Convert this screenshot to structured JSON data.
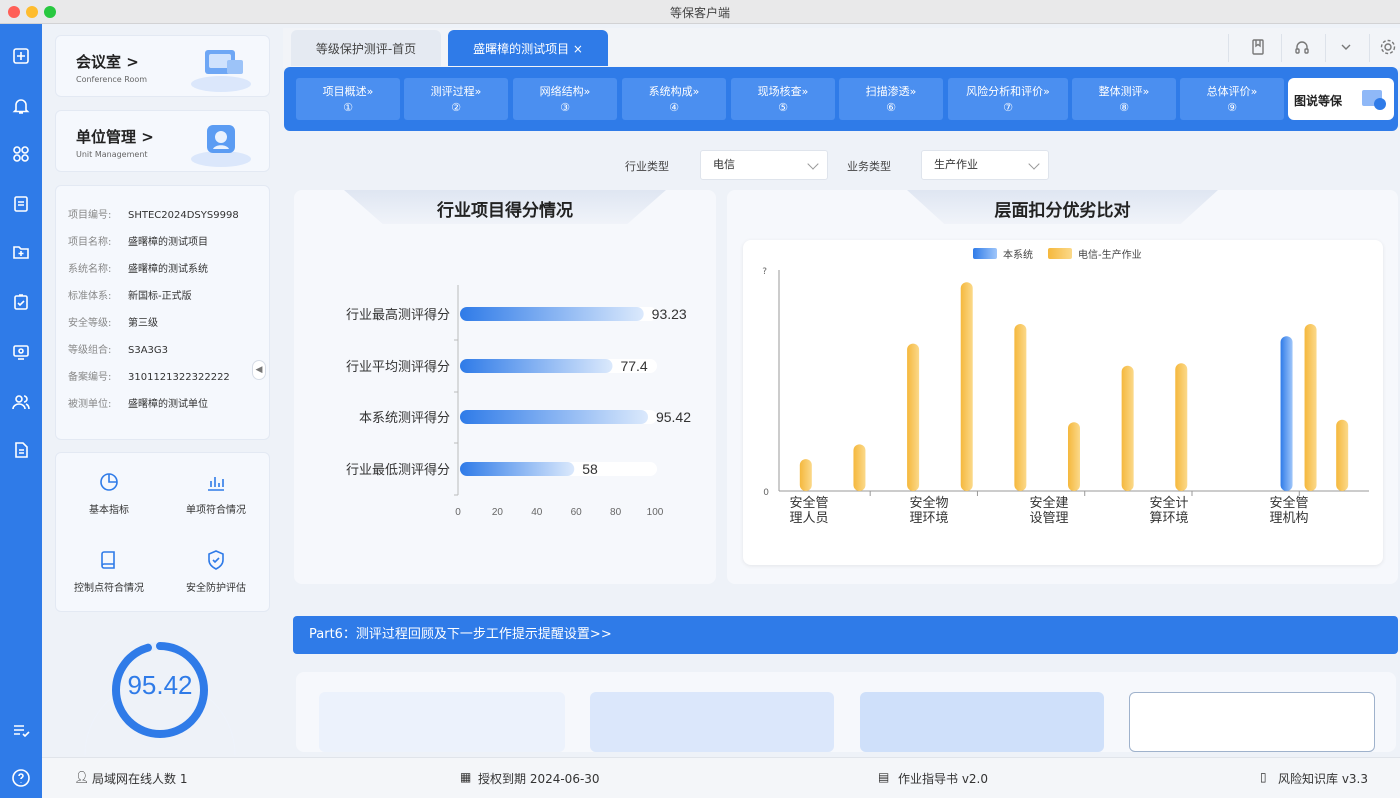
{
  "window": {
    "title": "等保客户端"
  },
  "left_panel": {
    "conference": {
      "title": "会议室 >",
      "subtitle": "Conference Room"
    },
    "unit": {
      "title": "单位管理 >",
      "subtitle": "Unit Management"
    },
    "info": [
      {
        "label": "项目编号:",
        "value": "SHTEC2024DSYS9998"
      },
      {
        "label": "项目名称:",
        "value": "盛曙樟的测试项目"
      },
      {
        "label": "系统名称:",
        "value": "盛曙樟的测试系统"
      },
      {
        "label": "标准体系:",
        "value": "新国标-正式版"
      },
      {
        "label": "安全等级:",
        "value": "第三级"
      },
      {
        "label": "等级组合:",
        "value": "S3A3G3"
      },
      {
        "label": "备案编号:",
        "value": "3101121322322222"
      },
      {
        "label": "被测单位:",
        "value": "盛曙樟的测试单位"
      }
    ],
    "collapse_glyph": "◀",
    "quick": [
      {
        "label": "基本指标"
      },
      {
        "label": "单项符合情况"
      },
      {
        "label": "控制点符合情况"
      },
      {
        "label": "安全防护评估"
      }
    ],
    "score": "95.42",
    "score_fraction": 0.9542
  },
  "tabs": [
    {
      "label": "等级保护测评-首页"
    },
    {
      "label": "盛曙樟的测试项目 ×"
    }
  ],
  "steps": [
    {
      "label": "项目概述»",
      "num": "①"
    },
    {
      "label": "测评过程»",
      "num": "②"
    },
    {
      "label": "网络结构»",
      "num": "③"
    },
    {
      "label": "系统构成»",
      "num": "④"
    },
    {
      "label": "现场核查»",
      "num": "⑤"
    },
    {
      "label": "扫描渗透»",
      "num": "⑥"
    },
    {
      "label": "风险分析和评价»",
      "num": "⑦"
    },
    {
      "label": "整体测评»",
      "num": "⑧"
    },
    {
      "label": "总体评价»",
      "num": "⑨"
    }
  ],
  "final_step": "图说等保",
  "filters": {
    "industry_label": "行业类型",
    "industry_value": "电信",
    "business_label": "业务类型",
    "business_value": "生产作业"
  },
  "panel_left_title": "行业项目得分情况",
  "panel_right_title": "层面扣分优劣比对",
  "chart_data": [
    {
      "type": "bar",
      "orientation": "horizontal",
      "categories": [
        "行业最高测评得分",
        "行业平均测评得分",
        "本系统测评得分",
        "行业最低测评得分"
      ],
      "values": [
        93.23,
        77.4,
        95.42,
        58
      ],
      "value_labels": [
        "93.23",
        "77.4",
        "95.42",
        "58"
      ],
      "xlim": [
        0,
        100
      ],
      "xticks": [
        "0",
        "20",
        "40",
        "60",
        "80",
        "100"
      ],
      "grid": false
    },
    {
      "type": "bar",
      "categories": [
        "安全管理人员",
        "安全物理环境",
        "安全建设管理",
        "安全计算环境",
        "安全管理机构"
      ],
      "x_tick_labels": [
        [
          "安全管",
          "理人员"
        ],
        [
          "安全物",
          "理环境"
        ],
        [
          "安全建",
          "设管理"
        ],
        [
          "安全计",
          "算环境"
        ],
        [
          "安全管",
          "理机构"
        ]
      ],
      "series": [
        {
          "name": "本系统",
          "color": "#3d8bf0",
          "values": [
            0,
            0,
            0,
            0,
            0,
            0,
            0,
            0,
            0,
            6.3,
            0
          ]
        },
        {
          "name": "电信-生产作业",
          "color": "#f5b83d",
          "values": [
            1.3,
            1.9,
            6.0,
            8.5,
            6.8,
            2.8,
            5.1,
            5.2,
            0,
            6.8,
            2.9
          ]
        }
      ],
      "slots": 11,
      "ylim": [
        0,
        9
      ],
      "yticks": [
        "0",
        "?"
      ],
      "legend": "top-center"
    }
  ],
  "part6": "Part6：测评过程回顾及下一步工作提示提醒设置>>",
  "status": {
    "online": "局域网在线人数 1",
    "license": "授权到期 2024-06-30",
    "guide": "作业指导书 v2.0",
    "kb": "风险知识库 v3.3"
  }
}
